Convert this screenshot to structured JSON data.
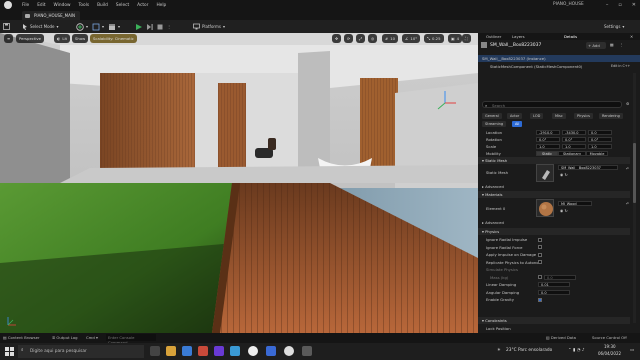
{
  "app": {
    "menu": [
      "File",
      "Edit",
      "Window",
      "Tools",
      "Build",
      "Select",
      "Actor",
      "Help"
    ],
    "project_name": "PIANO_HOUSE",
    "level_tab": "PIANO_HOUSE_MAIN"
  },
  "toolbar": {
    "select_mode": "Select Mode",
    "platforms": "Platforms",
    "settings": "Settings"
  },
  "viewport": {
    "perspective": "Perspective",
    "lit": "Lit",
    "show": "Show",
    "scalability": "Scalability: Cinematic",
    "grid_value": "10",
    "angle_value": "10°",
    "scale_value": "0.25",
    "cam_speed": "4"
  },
  "outliner": {
    "tab_outliner": "Outliner",
    "tab_layers": "Layers",
    "tab_details": "Details"
  },
  "details": {
    "actor_name": "SM_Wall__Box8223037",
    "add_button": "+ Add",
    "instance_label": "SM_Wall__Box8223037 (Instance)",
    "component_label": "StaticMeshComponent (StaticMeshComponent0)",
    "edit_cpp": "Edit in C++",
    "search_placeholder": "Search",
    "category_tabs": [
      "General",
      "Actor",
      "LOD",
      "Misc",
      "Physics",
      "Rendering"
    ],
    "category_tabs2": [
      "Streaming",
      "All"
    ],
    "transform_rows": [
      "Location",
      "Rotation",
      "Scale"
    ],
    "location_vals": [
      "-2910.0",
      "-3430.0",
      "0.0"
    ],
    "rotation_vals": [
      "0.0°",
      "0.0°",
      "0.0°"
    ],
    "scale_vals": [
      "1.0",
      "1.0",
      "1.0"
    ],
    "mobility_label": "Mobility",
    "mobility_options": [
      "Static",
      "Stationary",
      "Movable"
    ],
    "static_mesh_section": "Static Mesh",
    "static_mesh_label": "Static Mesh",
    "static_mesh_value": "SM_Wall__Box8223037",
    "advanced_label": "Advanced",
    "materials_section": "Materials",
    "element0_label": "Element 0",
    "element0_value": "MI_Wood",
    "advanced_label2": "Advanced",
    "physics_section": "Physics",
    "physics_rows": [
      {
        "label": "Ignore Radial Impulse",
        "value": ""
      },
      {
        "label": "Ignore Radial Force",
        "value": ""
      },
      {
        "label": "Apply Impulse on Damage",
        "value": ""
      },
      {
        "label": "Replicate Physics to Autono...",
        "value": ""
      },
      {
        "label": "Simulate Physics",
        "value": ""
      },
      {
        "label": "Mass (kg)",
        "value": "0.0"
      },
      {
        "label": "Linear Damping",
        "value": "0.01"
      },
      {
        "label": "Angular Damping",
        "value": "0.0"
      },
      {
        "label": "Enable Gravity",
        "value": ""
      }
    ],
    "constraints_section": "Constraints",
    "lock_position": "Lock Position"
  },
  "bottom": {
    "content_browser": "Content Browser",
    "output_log": "Output Log",
    "cmd": "Cmd",
    "cmd_placeholder": "Enter Console Command",
    "derived_data": "Derived Data",
    "source_control": "Source Control Off"
  },
  "taskbar": {
    "search_placeholder": "Digite aqui para pesquisar",
    "weather": "23°C  Parc ensolarado",
    "time": "19:30",
    "date": "06/04/2022"
  },
  "colors": {
    "accent_blue": "#2d6bd6",
    "play_green": "#3bb15a",
    "selection_orange": "#e0a030"
  }
}
